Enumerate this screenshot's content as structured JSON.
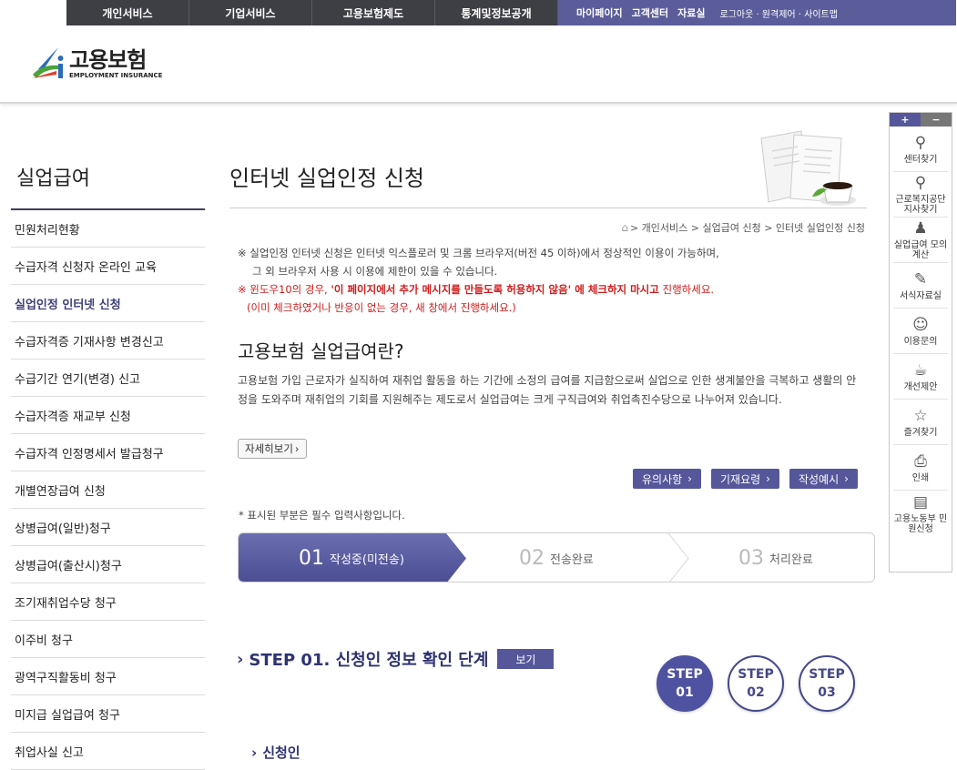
{
  "topnav": {
    "main": [
      "개인서비스",
      "기업서비스",
      "고용보험제도",
      "통계및정보공개"
    ],
    "util_bold": [
      "마이페이지",
      "고객센터",
      "자료실"
    ],
    "util_small": "로그아웃 · 원격제어 · 사이트맵"
  },
  "logo": {
    "kr": "고용보험",
    "en": "EMPLOYMENT INSURANCE"
  },
  "lnb": {
    "title": "실업급여",
    "items": [
      "민원처리현황",
      "수급자격 신청자 온라인 교육",
      "실업인정 인터넷 신청",
      "수급자격증 기재사항 변경신고",
      "수급기간 연기(변경) 신고",
      "수급자격증 재교부 신청",
      "수급자격 인정명세서 발급청구",
      "개별연장급여 신청",
      "상병급여(일반)청구",
      "상병급여(출산시)청구",
      "조기재취업수당 청구",
      "이주비 청구",
      "광역구직활동비 청구",
      "미지급 실업급여 청구",
      "취업사실 신고"
    ],
    "active_index": 2
  },
  "content": {
    "title": "인터넷 실업인정 신청",
    "breadcrumb": "> 개인서비스 > 실업급여 신청 > 인터넷 실업인정 신청",
    "notice1": "※ 실업인정 인터넷 신청은 인터넷 익스플로러 및 크롬 브라우저(버전 45 이하)에서 정상적인 이용이 가능하며,",
    "notice2": "그 외 브라우저 사용 시 이용에 제한이 있을 수 있습니다.",
    "notice3_a": "※ 윈도우10의 경우, ",
    "notice3_b": "'이 페이지에서 추가 메시지를 만들도록 허용하지 않음' 에 체크하지 마시고",
    "notice3_c": " 진행하세요.",
    "notice4": "(이미 체크하였거나 반응이 없는 경우, 새 창에서 진행하세요.)",
    "h2": "고용보험 실업급여란?",
    "desc": "고용보험 가입 근로자가 실직하여 재취업 활동을 하는 기간에 소정의 급여를 지급함으로써 실업으로 인한 생계불안을 극복하고 생활의 안정을 도와주며 재취업의 기회를 지원해주는 제도로서 실업급여는 크게 구직급여와 취업촉진수당으로 나누어져 있습니다.",
    "more": "자세히보기",
    "buttons": [
      "유의사항",
      "기재요령",
      "작성예시"
    ],
    "required_note": "* 표시된 부분은 필수 입력사항입니다.",
    "steps": [
      {
        "num": "01",
        "label": "작성중(미전송)"
      },
      {
        "num": "02",
        "label": "전송완료"
      },
      {
        "num": "03",
        "label": "처리완료"
      }
    ],
    "step_title": "STEP 01. 신청인 정보 확인 단계",
    "view_btn": "보기",
    "circles": [
      {
        "a": "STEP",
        "b": "01"
      },
      {
        "a": "STEP",
        "b": "02"
      },
      {
        "a": "STEP",
        "b": "03"
      }
    ],
    "sub_title": "신청인"
  },
  "quick": {
    "plus": "+",
    "minus": "−",
    "items": [
      {
        "icon": "map-pin-icon",
        "glyph": "⚲",
        "label": "센터찾기"
      },
      {
        "icon": "map-pin-icon",
        "glyph": "⚲",
        "label": "근로복지공단 지사찾기"
      },
      {
        "icon": "person-icon",
        "glyph": "♟",
        "label": "실업급여 모의계산"
      },
      {
        "icon": "edit-icon",
        "glyph": "✎",
        "label": "서식자료실"
      },
      {
        "icon": "chat-icon",
        "glyph": "☺",
        "label": "이용문의"
      },
      {
        "icon": "coffee-icon",
        "glyph": "☕",
        "label": "개선제안"
      },
      {
        "icon": "star-icon",
        "glyph": "☆",
        "label": "즐겨찾기"
      },
      {
        "icon": "print-icon",
        "glyph": "⎙",
        "label": "인쇄"
      },
      {
        "icon": "document-icon",
        "glyph": "▤",
        "label": "고용노동부 민원신청"
      }
    ]
  },
  "colors": {
    "nav_dark": "#3e3f44",
    "nav_accent": "#5b5d9b",
    "primary": "#55579a",
    "title": "#2e3370",
    "warning": "#d11c1c"
  }
}
